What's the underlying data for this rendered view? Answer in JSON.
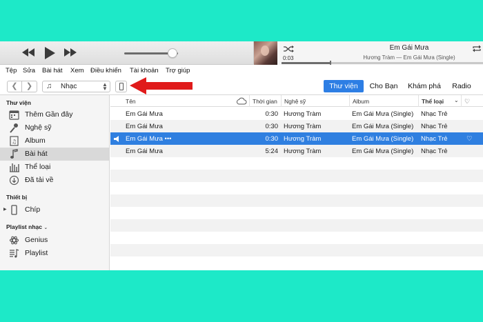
{
  "player": {
    "now_playing": {
      "title": "Em Gái Mưa",
      "subtitle": "Hương Tràm — Em Gái Mưa (Single)",
      "elapsed": "0:03",
      "progress_fraction": 0.24
    },
    "volume_fraction": 0.9,
    "icons": [
      "rewind-icon",
      "play-icon",
      "fast-forward-icon",
      "shuffle-icon",
      "repeat-icon"
    ]
  },
  "menu": [
    "Tệp",
    "Sửa",
    "Bài hát",
    "Xem",
    "Điều khiển",
    "Tài khoản",
    "Trợ giúp"
  ],
  "toolbar": {
    "media_kind": "Nhạc",
    "tabs": [
      "Thư viện",
      "Cho Bạn",
      "Khám phá",
      "Radio"
    ],
    "active_tab": "Thư viện",
    "accent_color": "#2d7ee4",
    "annotation_arrow_color": "#e01b1b"
  },
  "sidebar": {
    "library_header": "Thư viện",
    "library_items": [
      {
        "label": "Thêm Gần đây",
        "icon": "recently-added-icon"
      },
      {
        "label": "Nghệ sỹ",
        "icon": "artists-icon"
      },
      {
        "label": "Album",
        "icon": "album-icon"
      },
      {
        "label": "Bài hát",
        "icon": "songs-icon"
      },
      {
        "label": "Thể loại",
        "icon": "genres-icon"
      },
      {
        "label": "Đã tải về",
        "icon": "downloaded-icon"
      }
    ],
    "selected_item": "Bài hát",
    "devices_header": "Thiết bị",
    "device": {
      "label": "Chíp",
      "icon": "iphone-icon"
    },
    "playlists_header": "Playlist nhạc",
    "playlists": [
      {
        "label": "Genius",
        "icon": "genius-icon"
      },
      {
        "label": "Playlist",
        "icon": "playlist-icon"
      }
    ]
  },
  "table": {
    "columns": {
      "name": "Tên",
      "time": "Thời gian",
      "artist": "Nghệ sỹ",
      "album": "Album",
      "genre": "Thể loại"
    },
    "sorted_column": "Thể loại",
    "rows": [
      {
        "name": "Em Gái Mưa",
        "time": "0:30",
        "artist": "Hương Tràm",
        "album": "Em Gái Mưa (Single)",
        "genre": "Nhạc Trẻ",
        "selected": false,
        "playing": false
      },
      {
        "name": "Em Gái Mưa",
        "time": "0:30",
        "artist": "Hương Tràm",
        "album": "Em Gái Mưa (Single)",
        "genre": "Nhạc Trẻ",
        "selected": false,
        "playing": false
      },
      {
        "name": "Em Gái Mưa  •••",
        "time": "0:30",
        "artist": "Hương Tràm",
        "album": "Em Gái Mưa (Single)",
        "genre": "Nhạc Trẻ",
        "selected": true,
        "playing": true
      },
      {
        "name": "Em Gái Mưa",
        "time": "5:24",
        "artist": "Hương Tràm",
        "album": "Em Gái Mưa (Single)",
        "genre": "Nhạc Trẻ",
        "selected": false,
        "playing": false
      }
    ]
  }
}
